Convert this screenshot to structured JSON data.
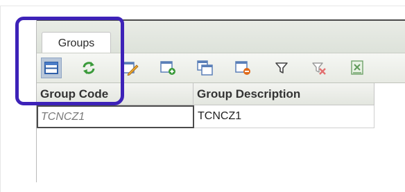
{
  "tabs": [
    {
      "label": "Groups",
      "active": true
    }
  ],
  "toolbar": {
    "buttons": [
      {
        "icon": "form-view-icon",
        "active": true
      },
      {
        "icon": "refresh-icon"
      },
      {
        "icon": "edit-record-icon"
      },
      {
        "icon": "new-record-icon"
      },
      {
        "icon": "copy-record-icon"
      },
      {
        "icon": "delete-record-icon"
      },
      {
        "icon": "filter-icon"
      },
      {
        "icon": "clear-filter-icon"
      },
      {
        "icon": "export-excel-icon"
      }
    ]
  },
  "grid": {
    "columns": [
      "Group Code",
      "Group Description"
    ],
    "rows": [
      {
        "code": "TCNCZ1",
        "description": "TCNCZ1"
      }
    ]
  },
  "colors": {
    "annotation": "#3d22b8",
    "selected_button": "#b9c7d9",
    "refresh": "#3a9a3a",
    "delete": "#e06a1a",
    "add": "#3a9a3a"
  }
}
